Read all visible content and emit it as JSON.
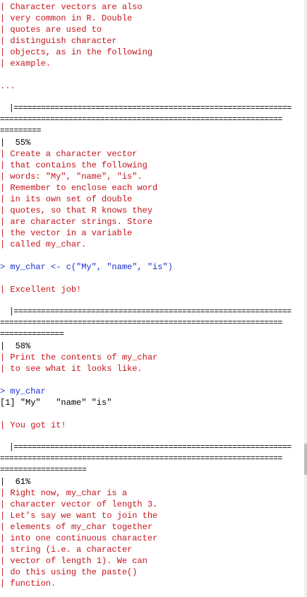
{
  "prompt_symbol": ">",
  "output_prefix": "[1]",
  "block1": {
    "lines": [
      "| Character vectors are also",
      "| very common in R. Double",
      "| quotes are used to",
      "| distinguish character",
      "| objects, as in the following",
      "| example."
    ],
    "ellipsis": "..."
  },
  "progress": [
    {
      "bar_lines": [
        "  |=============================================================",
        "==============================================================",
        "========="
      ],
      "percent": "|  55%"
    },
    {
      "bar_lines": [
        "  |=============================================================",
        "==============================================================",
        "=============="
      ],
      "percent": "|  58%"
    },
    {
      "bar_lines": [
        "  |=============================================================",
        "==============================================================",
        "==================="
      ],
      "percent": "|  61%"
    }
  ],
  "block2": {
    "lines": [
      "| Create a character vector",
      "| that contains the following",
      "| words: \"My\", \"name\", \"is\".",
      "| Remember to enclose each word",
      "| in its own set of double",
      "| quotes, so that R knows they",
      "| are character strings. Store",
      "| the vector in a variable",
      "| called my_char."
    ],
    "command": "my_char <- c(\"My\", \"name\", \"is\")",
    "feedback": "| Excellent job!"
  },
  "block3": {
    "lines": [
      "| Print the contents of my_char",
      "| to see what it looks like."
    ],
    "command": "my_char",
    "output": "\"My\"   \"name\" \"is\"",
    "feedback": "| You got it!"
  },
  "block4": {
    "lines": [
      "| Right now, my_char is a",
      "| character vector of length 3.",
      "| Let's say we want to join the",
      "| elements of my_char together",
      "| into one continuous character",
      "| string (i.e. a character",
      "| vector of length 1). We can",
      "| do this using the paste()",
      "| function."
    ]
  },
  "colors": {
    "message": "#c4141c",
    "command": "#1a2fd1",
    "output": "#000000",
    "background": "#ffffff"
  }
}
